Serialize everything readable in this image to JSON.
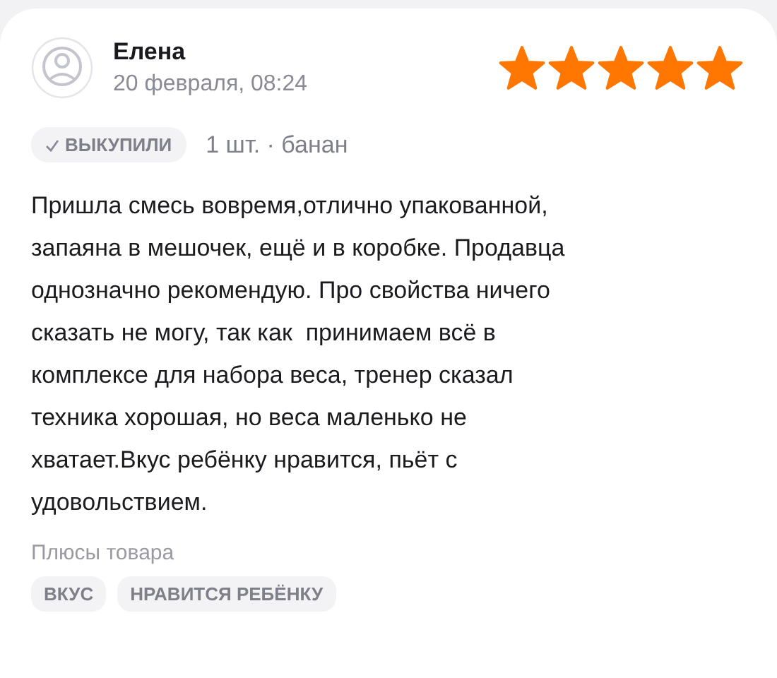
{
  "review": {
    "author": "Елена",
    "date": "20 февраля, 08:24",
    "stars": 5,
    "purchase_badge": "ВЫКУПИЛИ",
    "variant": "1 шт. · банан",
    "text": "Пришла смесь вовремя,отлично упакованной,\nзапаяна в мешочек, ещё и в коробке. Продавца\nоднозначно рекомендую. Про свойства ничего\nсказать не могу, так как  принимаем всё в\nкомплексе для набора веса, тренер сказал\nтехника хорошая, но веса маленько не\nхватает.Вкус ребёнку нравится, пьёт с\nудовольствием.",
    "pros_label": "Плюсы товара",
    "pros_tags": [
      "ВКУС",
      "НРАВИТСЯ РЕБЁНКУ"
    ]
  }
}
